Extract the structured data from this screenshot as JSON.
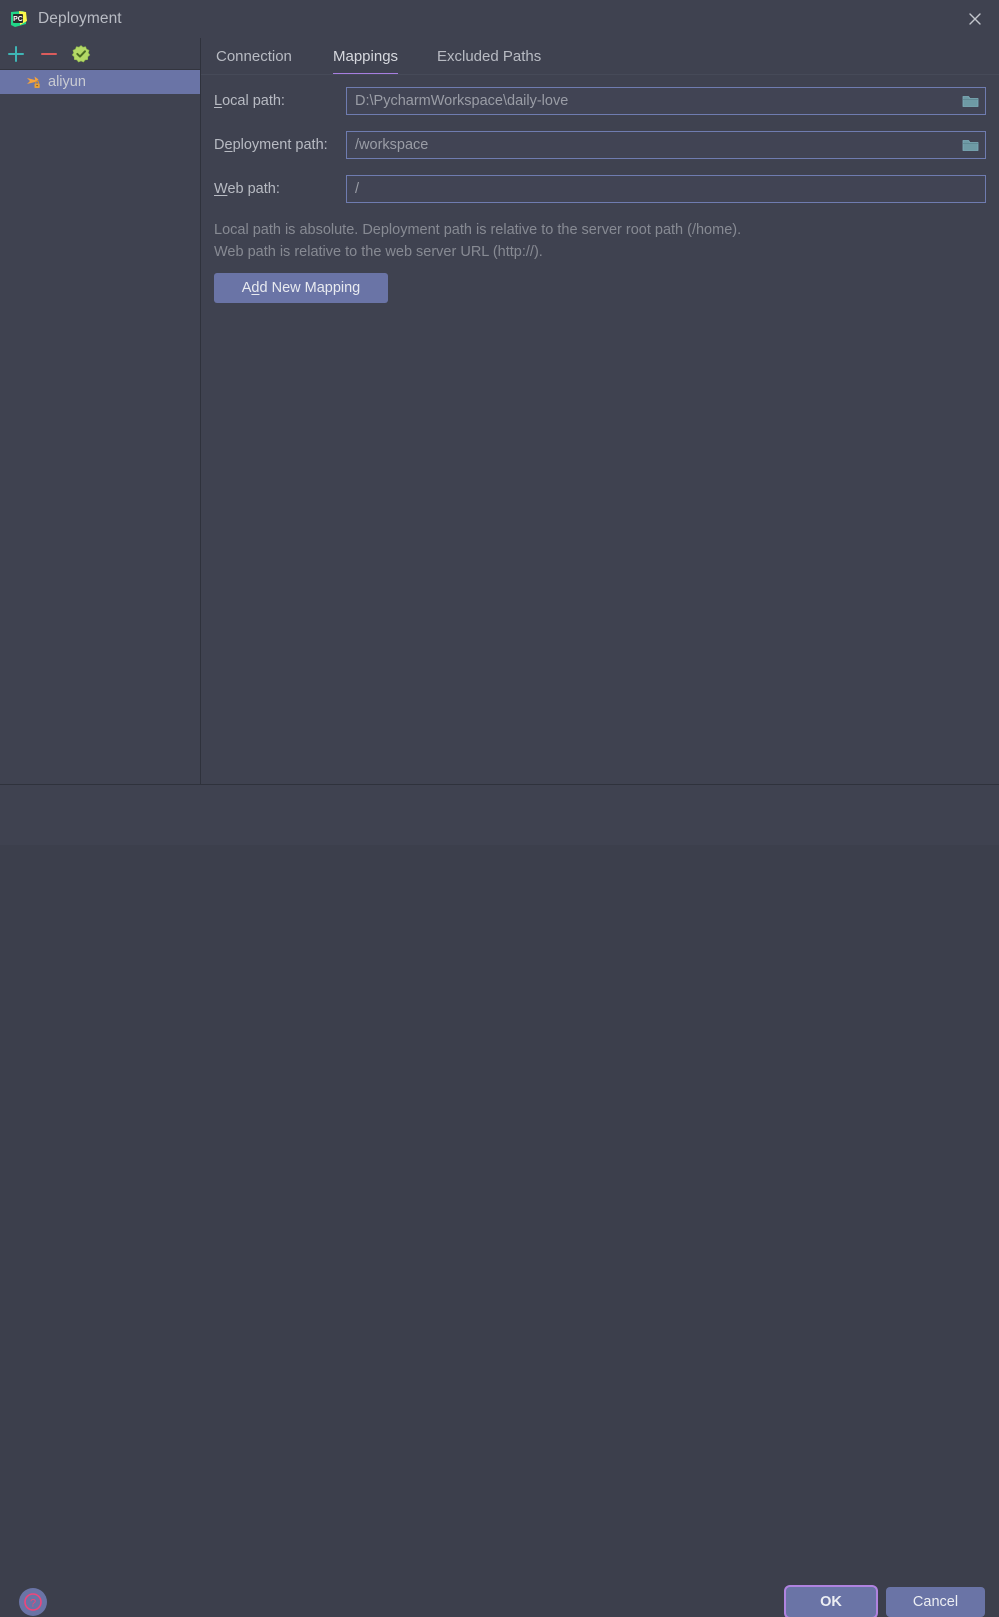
{
  "window": {
    "title": "Deployment",
    "app_icon": "pycharm-logo-icon",
    "close_icon": "close-icon"
  },
  "sidebar": {
    "toolbar": [
      {
        "name": "add-server-button",
        "icon": "plus-icon",
        "label": "+"
      },
      {
        "name": "remove-server-button",
        "icon": "minus-icon",
        "label": "−"
      },
      {
        "name": "validate-connection-button",
        "icon": "check-badge-icon",
        "label": ""
      }
    ],
    "items": [
      {
        "label": "aliyun",
        "icon": "sftp-server-icon",
        "selected": true
      }
    ]
  },
  "tabs": [
    {
      "label": "Connection",
      "active": false
    },
    {
      "label": "Mappings",
      "active": true
    },
    {
      "label": "Excluded Paths",
      "active": false
    }
  ],
  "form": {
    "fields": [
      {
        "label_prefix": "",
        "label_mnemonic": "L",
        "label_suffix": "ocal path:",
        "value": "D:\\PycharmWorkspace\\daily-love",
        "placeholder": "",
        "has_browse": true,
        "browse_icon": "folder-icon"
      },
      {
        "label_prefix": "D",
        "label_mnemonic": "e",
        "label_suffix": "ployment path:",
        "value": "/workspace",
        "placeholder": "",
        "has_browse": true,
        "browse_icon": "folder-icon"
      },
      {
        "label_prefix": "",
        "label_mnemonic": "W",
        "label_suffix": "eb path:",
        "value": "/",
        "placeholder": "",
        "has_browse": false,
        "browse_icon": ""
      }
    ],
    "hints": [
      "Local path is absolute. Deployment path is relative to the server root path (/home).",
      "Web path is relative to the web server URL (http://)."
    ],
    "add_mapping": {
      "prefix": "A",
      "mnemonic": "d",
      "suffix": "d New Mapping"
    }
  },
  "footer": {
    "help_label": "?",
    "help_icon": "help-question-icon",
    "ok_label": "OK",
    "cancel_label": "Cancel"
  },
  "colors": {
    "background": "#3f4250",
    "selection": "#6a74a6",
    "tab_accent": "#a77ee0",
    "field_border": "#6f7cb0",
    "focus_ring": "#b083e0",
    "add_icon": "#3fb5b5",
    "remove_icon": "#db5c5c",
    "check_icon": "#9ccc5a",
    "server_icon": "#f5a33c",
    "folder_icon": "#6e9aa5"
  }
}
